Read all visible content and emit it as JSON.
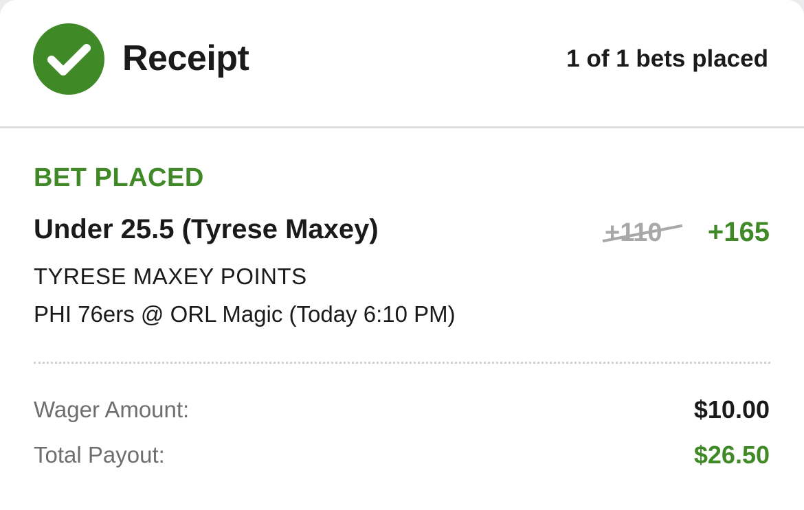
{
  "colors": {
    "accent_green": "#3f8a26",
    "text_dark": "#1a1a1a",
    "text_muted": "#6e6e6e",
    "strike_gray": "#a8a8a8"
  },
  "header": {
    "icon": "check-circle-icon",
    "title": "Receipt",
    "bets_placed": "1 of 1 bets placed"
  },
  "bet": {
    "status": "BET PLACED",
    "selection": "Under 25.5 (Tyrese Maxey)",
    "original_odds": "+110",
    "boosted_odds": "+165",
    "market": "TYRESE MAXEY POINTS",
    "event": "PHI 76ers @ ORL Magic (Today 6:10 PM)"
  },
  "summary": {
    "wager_label": "Wager Amount:",
    "wager_value": "$10.00",
    "payout_label": "Total Payout:",
    "payout_value": "$26.50"
  }
}
